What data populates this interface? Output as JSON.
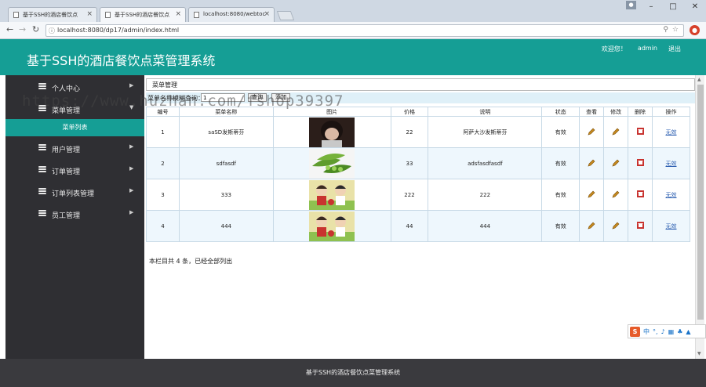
{
  "browser": {
    "tabs": [
      {
        "title": "基于SSH的酒店餐饮点",
        "active": false
      },
      {
        "title": "基于SSH的酒店餐饮点",
        "active": true
      },
      {
        "title": "localhost:8080/webtoc",
        "active": false
      }
    ],
    "url": "localhost:8080/dp17/admin/index.html"
  },
  "header": {
    "title": "基于SSH的酒店餐饮点菜管理系统",
    "welcome": "欢迎您！",
    "user": "admin",
    "logout": "退出"
  },
  "sidebar": {
    "items": [
      {
        "label": "个人中心"
      },
      {
        "label": "菜单管理"
      },
      {
        "label": "用户管理"
      },
      {
        "label": "订单管理"
      },
      {
        "label": "订单列表管理"
      },
      {
        "label": "员工管理"
      }
    ],
    "sub_active": "菜单列表"
  },
  "main": {
    "breadcrumb": "菜单管理",
    "search": {
      "label": "菜单名称模糊查询：",
      "value": "1",
      "query_btn": "查询",
      "add_btn": "添加"
    },
    "columns": [
      "编号",
      "菜单名称",
      "图片",
      "价格",
      "说明",
      "状态",
      "查看",
      "修改",
      "删除",
      "操作"
    ],
    "rows": [
      {
        "id": "1",
        "name": "saSD发斯蒂芬",
        "price": "22",
        "desc": "阿萨大沙发斯蒂芬",
        "status": "有效",
        "op": "无效"
      },
      {
        "id": "2",
        "name": "sdfasdf",
        "price": "33",
        "desc": "adsfasdfasdf",
        "status": "有效",
        "op": "无效"
      },
      {
        "id": "3",
        "name": "333",
        "price": "222",
        "desc": "222",
        "status": "有效",
        "op": "无效"
      },
      {
        "id": "4",
        "name": "444",
        "price": "44",
        "desc": "444",
        "status": "有效",
        "op": "无效"
      }
    ],
    "total": "本栏目共 4 条，已经全部列出"
  },
  "footer": "基于SSH的酒店餐饮点菜管理系统",
  "watermark": "https://www.huzhan.com/fshop39397",
  "ime": {
    "lang": "中"
  },
  "colors": {
    "primary": "#159e95",
    "sidebar": "#2f2f33",
    "footer": "#3a3a3e",
    "row_alt": "#eef7fd"
  }
}
